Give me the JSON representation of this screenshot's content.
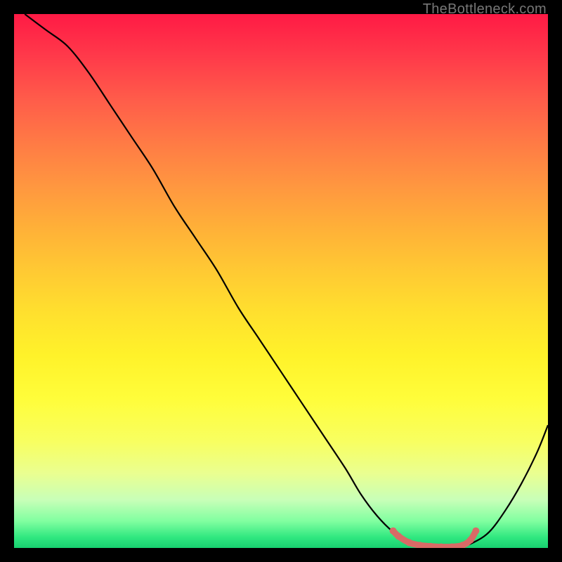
{
  "watermark": "TheBottleneck.com",
  "chart_data": {
    "type": "line",
    "title": "",
    "xlabel": "",
    "ylabel": "",
    "xlim": [
      0,
      100
    ],
    "ylim": [
      0,
      100
    ],
    "series": [
      {
        "name": "bottleneck-curve",
        "x": [
          2,
          6,
          10,
          14,
          18,
          22,
          26,
          30,
          34,
          38,
          42,
          46,
          50,
          54,
          58,
          62,
          65,
          68,
          71,
          74,
          77,
          80,
          83,
          86,
          89,
          92,
          95,
          98,
          100
        ],
        "y": [
          100,
          97,
          94,
          89,
          83,
          77,
          71,
          64,
          58,
          52,
          45,
          39,
          33,
          27,
          21,
          15,
          10,
          6,
          3,
          1,
          0,
          0,
          0,
          1,
          3,
          7,
          12,
          18,
          23
        ]
      }
    ],
    "highlight_points": {
      "x": [
        71,
        72,
        74,
        76,
        78,
        80,
        82,
        84,
        85.5,
        86.5
      ],
      "y": [
        3.2,
        2.2,
        1.0,
        0.5,
        0.3,
        0.2,
        0.2,
        0.5,
        1.5,
        3.2
      ],
      "color": "#d96a66"
    },
    "background_gradient": {
      "orientation": "vertical-top-to-bottom",
      "stops": [
        {
          "pos": 0.0,
          "color": "#ff1a45"
        },
        {
          "pos": 0.5,
          "color": "#ffd433"
        },
        {
          "pos": 0.85,
          "color": "#f0ff80"
        },
        {
          "pos": 1.0,
          "color": "#18d070"
        }
      ]
    }
  }
}
